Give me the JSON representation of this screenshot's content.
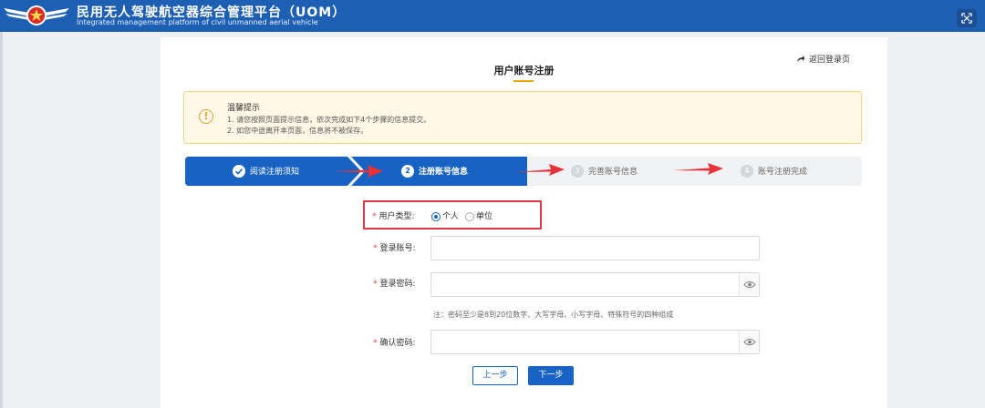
{
  "header": {
    "title": "民用无人驾驶航空器综合管理平台（UOM）",
    "subtitle": "Integrated management platform of civil unmanned aerial vehicle"
  },
  "page": {
    "title": "用户账号注册",
    "back_link": "返回登录页"
  },
  "notice": {
    "title": "温馨提示",
    "lines": [
      "1. 请您按照页面提示信息，依次完成如下4个步骤的信息提交。",
      "2. 如您中途离开本页面，信息将不被保存。"
    ]
  },
  "steps": [
    {
      "label": "阅读注册须知",
      "state": "done"
    },
    {
      "label": "注册账号信息",
      "number": "2",
      "state": "active"
    },
    {
      "label": "完善账号信息",
      "number": "3",
      "state": "pending"
    },
    {
      "label": "账号注册完成",
      "number": "4",
      "state": "pending"
    }
  ],
  "form": {
    "user_type_label": "用户类型:",
    "user_type_options": [
      "个人",
      "单位"
    ],
    "user_type_selected": "个人",
    "account_label": "登录账号:",
    "account_value": "",
    "password_label": "登录密码:",
    "password_value": "",
    "password_hint": "注：密码至少是8到20位数字、大写字母、小写字母、特殊符号的四种组成",
    "confirm_label": "确认密码:",
    "confirm_value": "",
    "required_mark": "*"
  },
  "buttons": {
    "prev": "上一步",
    "next": "下一步"
  },
  "colors": {
    "header": "#1d5fb3",
    "primary": "#1762c2",
    "annotation": "#e0393e",
    "notice_bg": "#fff8e6"
  }
}
